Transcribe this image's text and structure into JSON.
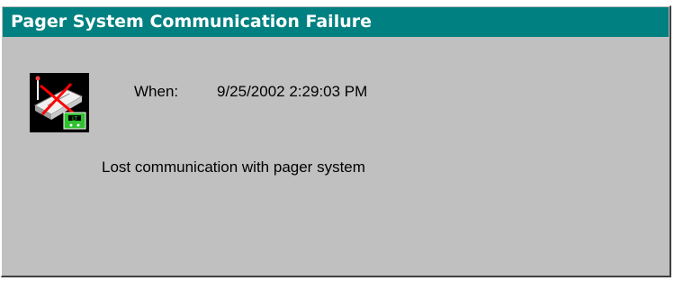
{
  "window": {
    "title": "Pager System Communication Failure"
  },
  "details": {
    "when_label": "When:",
    "when_value": "9/25/2002 2:29:03 PM",
    "message": "Lost communication with pager system"
  },
  "icon": {
    "name": "pager-failure-icon",
    "badge_text": "LT"
  },
  "colors": {
    "title_bar": "#008080",
    "title_text": "#ffffff",
    "panel": "#c0c0c0",
    "error_cross": "#ff0000",
    "badge": "#00c000"
  }
}
